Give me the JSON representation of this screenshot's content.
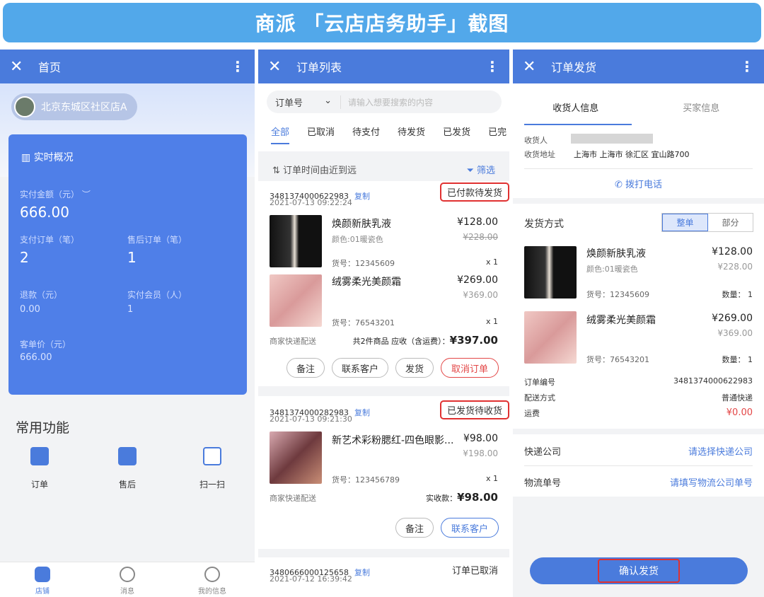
{
  "banner": "商派 「云店店务助手」截图",
  "panel1": {
    "title": "首页",
    "store": "北京东城区社区店A",
    "overview_title": "实时概况",
    "paid_label": "实付金额（元）",
    "paid_value": "666.00",
    "pay_orders_label": "支付订单（笔）",
    "pay_orders_value": "2",
    "after_sale_label": "售后订单（笔）",
    "after_sale_value": "1",
    "refund_label": "退款（元）",
    "refund_value": "0.00",
    "members_label": "实付会员（人）",
    "members_value": "1",
    "avg_label": "客单价（元）",
    "avg_value": "666.00",
    "common_title": "常用功能",
    "functions": [
      "订单",
      "售后",
      "扫一扫"
    ],
    "tabs": [
      "店铺",
      "消息",
      "我的信息"
    ]
  },
  "panel2": {
    "title": "订单列表",
    "search_select": "订单号",
    "search_placeholder": "请输入想要搜索的内容",
    "tabs": [
      "全部",
      "已取消",
      "待支付",
      "待发货",
      "已发货",
      "已完"
    ],
    "sort_label": "订单时间由近到远",
    "filter_label": "筛选",
    "orders": [
      {
        "no": "3481374000622983",
        "copy": "复制",
        "time": "2021-07-13 09:22:24",
        "status": "已付款待发货",
        "items": [
          {
            "name": "焕颜新肤乳液",
            "variant": "颜色:01暖瓷色",
            "price": "¥128.00",
            "orig": "¥228.00",
            "sku": "货号：12345609",
            "qty": "x 1"
          },
          {
            "name": "绒雾柔光美颜霜",
            "variant": "",
            "price": "¥269.00",
            "orig": "¥369.00",
            "sku": "货号：76543201",
            "qty": "x 1"
          }
        ],
        "delivery": "商家快递配送",
        "summary": "共2件商品 应收（含运费）：",
        "total": "¥397.00",
        "buttons": [
          "备注",
          "联系客户",
          "发货",
          "取消订单"
        ]
      },
      {
        "no": "3481374000282983",
        "copy": "复制",
        "time": "2021-07-13 09:21:30",
        "status": "已发货待收货",
        "items": [
          {
            "name": "新艺术彩粉腮红-四色眼影...",
            "variant": "",
            "price": "¥98.00",
            "orig": "¥198.00",
            "sku": "货号：123456789",
            "qty": "x 1"
          }
        ],
        "delivery": "商家快递配送",
        "summary": "实收款：",
        "total": "¥98.00",
        "buttons": [
          "备注",
          "联系客户"
        ]
      },
      {
        "no": "3480666000125658",
        "copy": "复制",
        "time": "2021-07-12 16:39:42",
        "status": "订单已取消"
      }
    ]
  },
  "panel3": {
    "title": "订单发货",
    "tabs": [
      "收货人信息",
      "买家信息"
    ],
    "receiver_label": "收货人",
    "address_label": "收货地址",
    "address": "上海市 上海市 徐汇区 宜山路700",
    "call": "拨打电话",
    "ship_method_label": "发货方式",
    "seg": [
      "整单",
      "部分"
    ],
    "items": [
      {
        "name": "焕颜新肤乳液",
        "variant": "颜色:01暖瓷色",
        "price": "¥128.00",
        "orig": "¥228.00",
        "sku": "货号：12345609",
        "qty": "数量： 1"
      },
      {
        "name": "绒雾柔光美颜霜",
        "variant": "",
        "price": "¥269.00",
        "orig": "¥369.00",
        "sku": "货号：76543201",
        "qty": "数量： 1"
      }
    ],
    "order_no_label": "订单编号",
    "order_no": "3481374000622983",
    "delivery_label": "配送方式",
    "delivery": "普通快递",
    "freight_label": "运费",
    "freight": "¥0.00",
    "express_label": "快递公司",
    "express_value": "请选择快递公司",
    "tracking_label": "物流单号",
    "tracking_value": "请填写物流公司单号",
    "confirm": "确认发货"
  },
  "colors": {
    "primary": "#4a7bdc",
    "banner": "#52a8ea",
    "highlight": "#e03131",
    "price_red": "#e34646"
  }
}
